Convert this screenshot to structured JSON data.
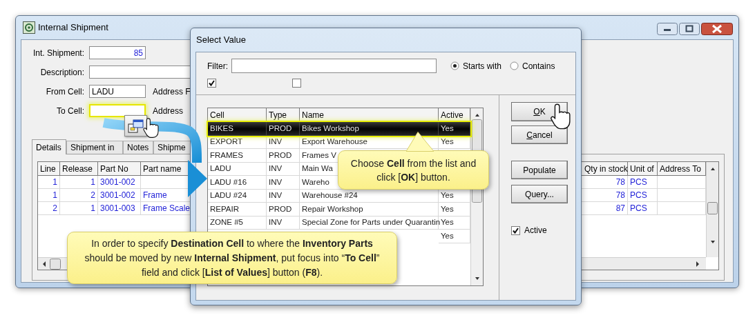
{
  "main_window": {
    "title": "Internal Shipment",
    "fields": [
      {
        "label": "Int. Shipment:",
        "value": "85",
        "kind": "number",
        "focused": false
      },
      {
        "label": "Description:",
        "kind": "text",
        "focused": false
      },
      {
        "label": "From Cell:",
        "value": "LADU",
        "kind": "text",
        "focused": false,
        "side_label": "Address F"
      },
      {
        "label": "To Cell:",
        "kind": "text",
        "focused": true,
        "side_label": "Address"
      }
    ],
    "tabs": [
      {
        "label": "Details",
        "selected": true
      },
      {
        "label": "Shipment in",
        "selected": false
      },
      {
        "label": "Notes",
        "selected": false
      },
      {
        "label": "Shipme",
        "selected": false
      }
    ],
    "grid": {
      "columns": [
        "Line",
        "Release",
        "Part No",
        "Part name"
      ],
      "right_columns": [
        "Qty in stock",
        "Unit of",
        "Address To"
      ],
      "rows": [
        {
          "line": "1",
          "release": "1",
          "part_no": "3001-002",
          "qty": "78",
          "unit": "PCS"
        },
        {
          "line": "1",
          "release": "2",
          "part_no": "3001-002",
          "part_name": "Frame",
          "qty": "78",
          "unit": "PCS"
        },
        {
          "line": "2",
          "release": "1",
          "part_no": "3001-003",
          "part_name": "Frame Scale",
          "qty": "87",
          "unit": "PCS"
        }
      ]
    }
  },
  "dialog": {
    "title": "Select Value",
    "filter_label": "Filter:",
    "match_options": [
      {
        "label": "Starts with",
        "selected": true
      },
      {
        "label": "Contains",
        "selected": false
      }
    ],
    "checkboxes": [
      {
        "checked": true
      },
      {
        "checked": false
      }
    ],
    "list": {
      "columns": [
        "Cell",
        "Type",
        "Name",
        "Active"
      ],
      "rows": [
        {
          "cell": "BIKES",
          "type": "PROD",
          "name": "Bikes Workshop",
          "active": "Yes",
          "selected": true
        },
        {
          "cell": "EXPORT",
          "type": "INV",
          "name": "Export Warehouse",
          "active": "Yes",
          "selected": false
        },
        {
          "cell": "FRAMES",
          "type": "PROD",
          "name": "Frames V",
          "selected": false
        },
        {
          "cell": "LADU",
          "type": "INV",
          "name": "Main Wa",
          "selected": false
        },
        {
          "cell": "LADU #16",
          "type": "INV",
          "name": "Wareho",
          "selected": false
        },
        {
          "cell": "LADU #24",
          "type": "INV",
          "name": "Warehouse #24",
          "active": "Yes",
          "selected": false
        },
        {
          "cell": "REPAIR",
          "type": "PROD",
          "name": "Repair Workshop",
          "active": "Yes",
          "selected": false
        },
        {
          "cell": "ZONE #5",
          "type": "INV",
          "name": "Special Zone for Parts under Quarantin",
          "active": "Yes",
          "selected": false
        },
        {
          "active": "Yes",
          "selected": false
        }
      ]
    },
    "buttons": [
      {
        "label": "OK",
        "mnemonic": true
      },
      {
        "label": "Cancel",
        "mnemonic": true
      },
      {
        "label": "Populate",
        "mnemonic": false
      },
      {
        "label": "Query...",
        "mnemonic": false
      }
    ],
    "active_checkbox": {
      "label": "Active",
      "checked": true
    }
  },
  "callouts": [
    {
      "text": "Choose **Cell** from the list and click [**OK**] button."
    },
    {
      "text": "In order to specify **Destination Cell** to where the **Inventory Parts** should be moved by new **Internal Shipment**, put focus into “**To Cell**” field and click [**List of Values**] button (**F8**)."
    }
  ]
}
